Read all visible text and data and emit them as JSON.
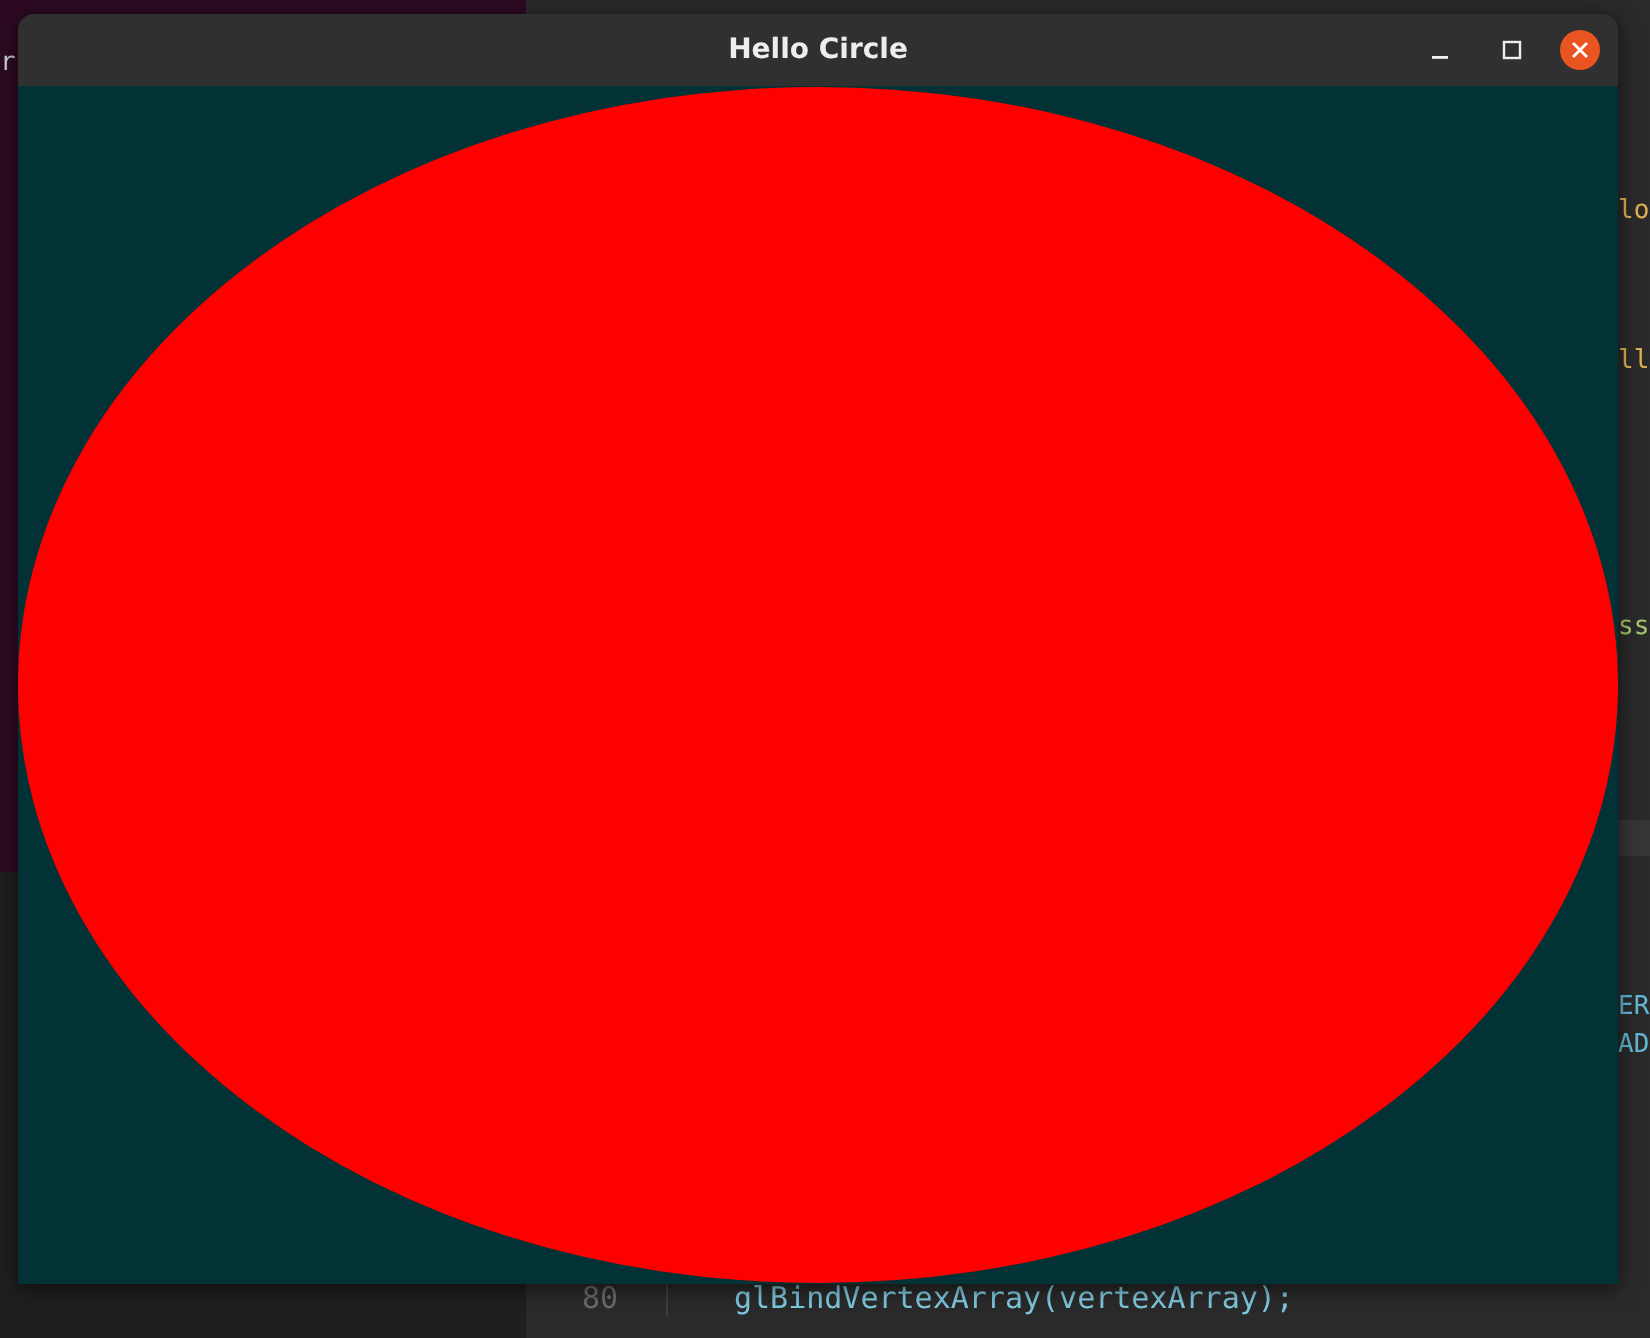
{
  "background": {
    "terminal_fragment": "r",
    "editor_fragments": [
      {
        "text": "lo",
        "color": "#e0b050"
      },
      {
        "text": "ll",
        "color": "#e0b050"
      },
      {
        "text": "ss",
        "color": "#a6c46a"
      },
      {
        "text": "ER",
        "color": "#5fb8d6"
      },
      {
        "text": "AD",
        "color": "#5fb8d6"
      }
    ],
    "code_lines": [
      {
        "number": "80",
        "text": "glBindVertexArray(vertexArray);"
      }
    ]
  },
  "window": {
    "title": "Hello Circle"
  }
}
